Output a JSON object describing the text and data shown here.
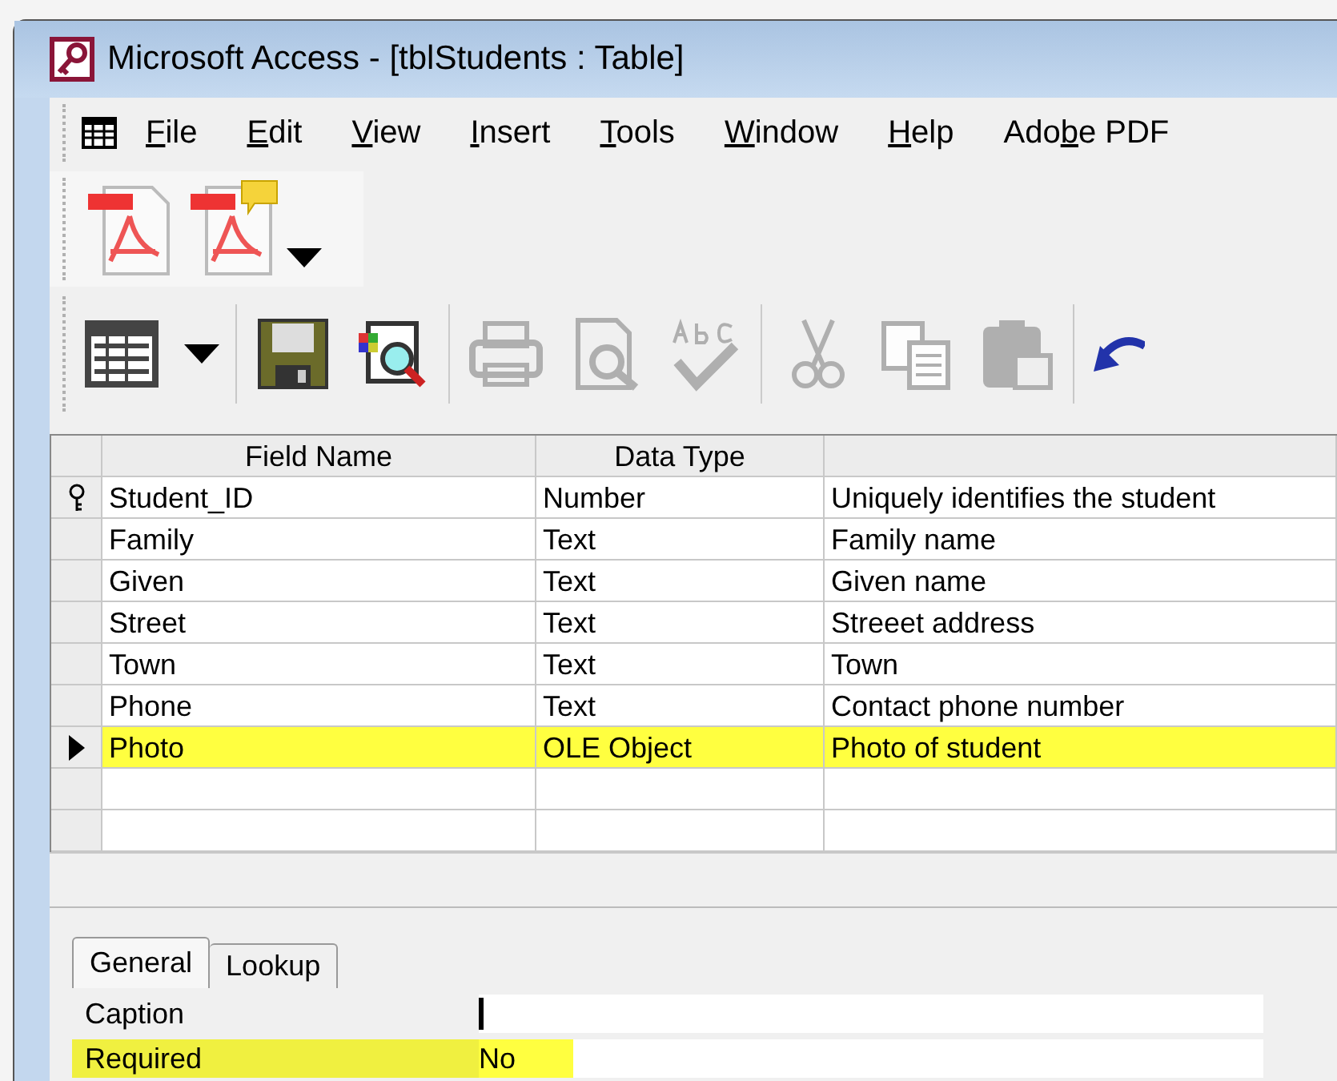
{
  "window": {
    "title": "Microsoft Access - [tblStudents : Table]"
  },
  "menu": [
    {
      "access_key": "F",
      "rest": "ile"
    },
    {
      "access_key": "E",
      "rest": "dit"
    },
    {
      "access_key": "V",
      "rest": "iew"
    },
    {
      "access_key": "I",
      "rest": "nsert"
    },
    {
      "access_key": "T",
      "rest": "ools"
    },
    {
      "access_key": "W",
      "rest": "indow"
    },
    {
      "access_key": "H",
      "rest": "elp"
    },
    {
      "prefix": "Ado",
      "access_key": "b",
      "rest": "e PDF"
    }
  ],
  "pdf_toolbar": [
    {
      "kind": "pdf",
      "dropdown": false
    },
    {
      "kind": "pdf-comment",
      "dropdown": true
    }
  ],
  "toolbar": [
    {
      "kind": "datasheet",
      "disabled": false,
      "dropdown": true,
      "group_start": false
    },
    {
      "kind": "save",
      "disabled": false,
      "dropdown": false,
      "group_start": true
    },
    {
      "kind": "properties",
      "disabled": false,
      "dropdown": false,
      "group_start": false
    },
    {
      "kind": "print",
      "disabled": true,
      "dropdown": false,
      "group_start": true
    },
    {
      "kind": "preview",
      "disabled": true,
      "dropdown": false,
      "group_start": false
    },
    {
      "kind": "spelling",
      "disabled": true,
      "dropdown": false,
      "group_start": false
    },
    {
      "kind": "cut",
      "disabled": true,
      "dropdown": false,
      "group_start": true
    },
    {
      "kind": "copy",
      "disabled": true,
      "dropdown": false,
      "group_start": false
    },
    {
      "kind": "paste",
      "disabled": true,
      "dropdown": false,
      "group_start": false
    },
    {
      "kind": "undo",
      "disabled": false,
      "dropdown": false,
      "group_start": true
    }
  ],
  "table": {
    "columns": [
      "Field Name",
      "Data Type"
    ],
    "rows": [
      {
        "field": "Student_ID",
        "type": "Number",
        "description": "Uniquely identifies the student",
        "primary_key": true,
        "selected": false
      },
      {
        "field": "Family",
        "type": "Text",
        "description": "Family name",
        "primary_key": false,
        "selected": false
      },
      {
        "field": "Given",
        "type": "Text",
        "description": "Given name",
        "primary_key": false,
        "selected": false
      },
      {
        "field": "Street",
        "type": "Text",
        "description": "Streeet address",
        "primary_key": false,
        "selected": false
      },
      {
        "field": "Town",
        "type": "Text",
        "description": "Town",
        "primary_key": false,
        "selected": false
      },
      {
        "field": "Phone",
        "type": "Text",
        "description": "Contact phone number",
        "primary_key": false,
        "selected": false
      },
      {
        "field": "Photo",
        "type": "OLE Object",
        "description": "Photo of student",
        "primary_key": false,
        "selected": true
      }
    ]
  },
  "properties": {
    "tabs": [
      {
        "label": "General",
        "selected": true
      },
      {
        "label": "Lookup",
        "selected": false
      }
    ],
    "rows": [
      {
        "label": "Caption",
        "value": "",
        "highlighted": false,
        "cursor": true
      },
      {
        "label": "Required",
        "value": "No",
        "highlighted": true,
        "cursor": false
      }
    ]
  }
}
